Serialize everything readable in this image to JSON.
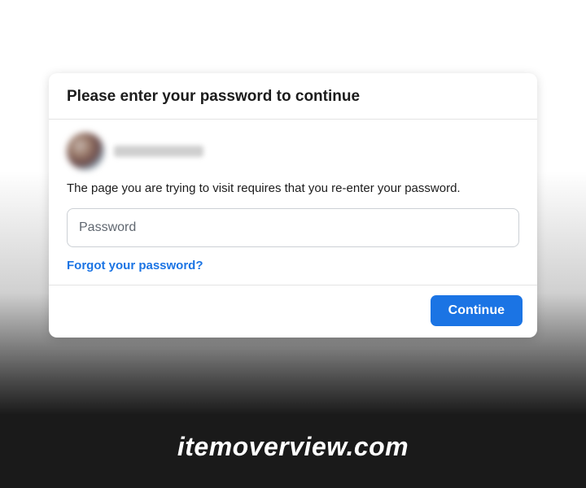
{
  "dialog": {
    "title": "Please enter your password to continue",
    "prompt": "The page you are trying to visit requires that you re-enter your password.",
    "password_placeholder": "Password",
    "forgot_label": "Forgot your password?",
    "continue_label": "Continue"
  },
  "watermark": {
    "text": "itemoverview.com"
  },
  "colors": {
    "primary": "#1b74e4"
  }
}
